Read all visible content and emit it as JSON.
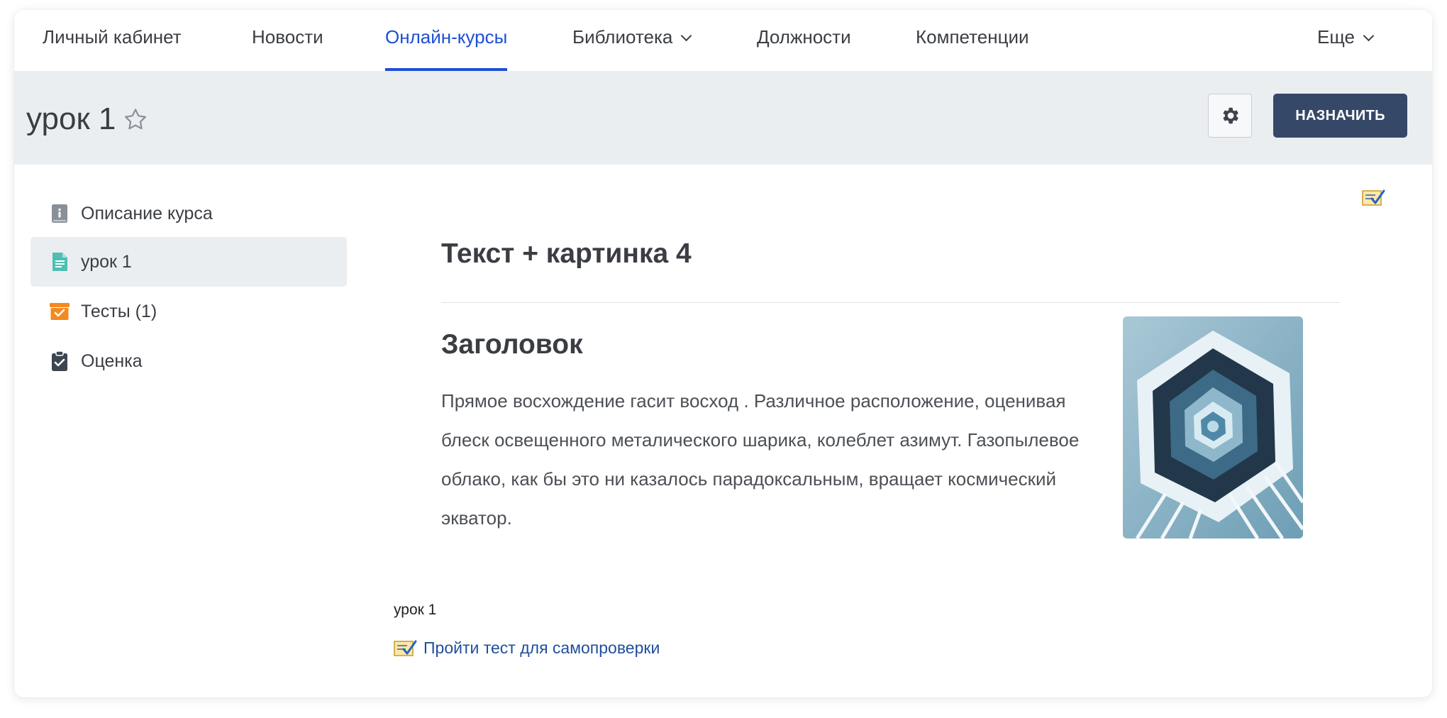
{
  "nav": {
    "items": [
      {
        "label": "Личный кабинет"
      },
      {
        "label": "Новости"
      },
      {
        "label": "Онлайн-курсы"
      },
      {
        "label": "Библиотека"
      },
      {
        "label": "Должности"
      },
      {
        "label": "Компетенции"
      }
    ],
    "active_index": 2,
    "more_label": "Еще"
  },
  "header": {
    "title": "урок 1",
    "assign_label": "НАЗНАЧИТЬ"
  },
  "sidebar": {
    "items": [
      {
        "label": "Описание курса",
        "icon": "info-book-icon",
        "color": "#8a9099"
      },
      {
        "label": "урок 1",
        "icon": "document-icon",
        "color": "#4fbfb3"
      },
      {
        "label": "Тесты (1)",
        "icon": "tests-box-icon",
        "color": "#f5891f"
      },
      {
        "label": "Оценка",
        "icon": "clipboard-check-icon",
        "color": "#3d4550"
      }
    ],
    "active_index": 1
  },
  "content": {
    "title": "Текст + картинка 4",
    "heading": "Заголовок",
    "body": "Прямое восхождение гасит восход . Различное расположение, оценивая блеск освещенного металического шарика, колеблет азимут. Газопылевое облако, как бы это ни казалось парадоксальным, вращает космический экватор.",
    "lesson_name": "урок 1",
    "self_test_link": "Пройти тест для самопроверки"
  },
  "colors": {
    "accent": "#1d4fd6",
    "assign_button": "#364868",
    "band": "#ebeef1",
    "link": "#1f4e9e"
  }
}
